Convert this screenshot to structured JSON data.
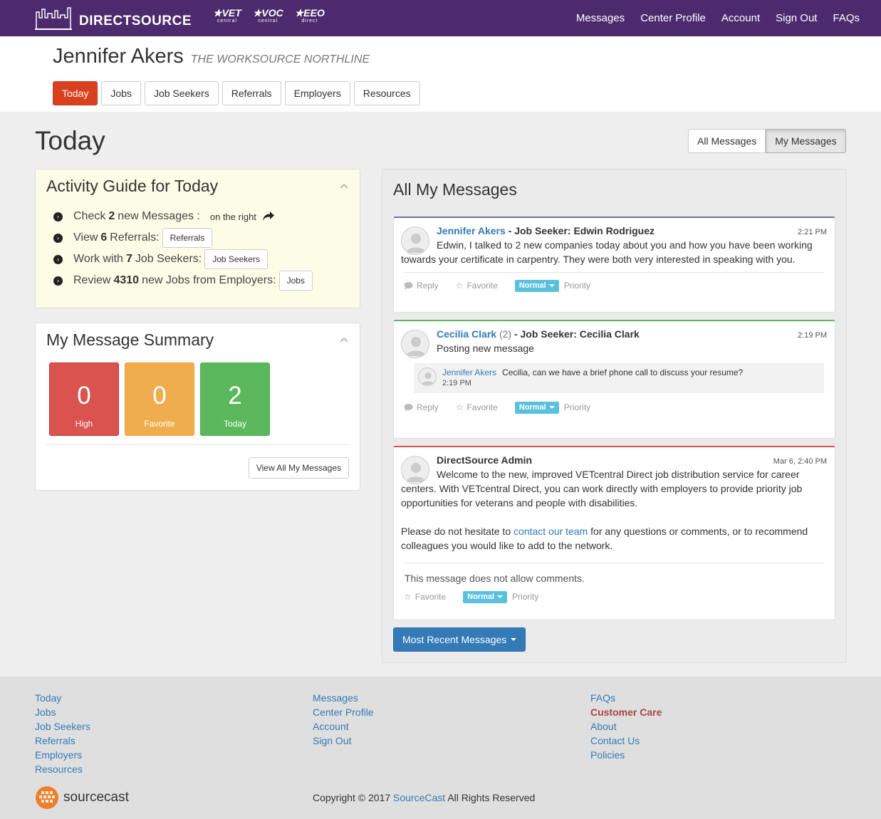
{
  "brand": {
    "name": "DIRECTSOURCE",
    "partners": [
      {
        "name": "VET",
        "sub": "central"
      },
      {
        "name": "VOC",
        "sub": "central"
      },
      {
        "name": "EEO",
        "sub": "direct"
      }
    ]
  },
  "topnav": [
    "Messages",
    "Center Profile",
    "Account",
    "Sign Out",
    "FAQs"
  ],
  "header": {
    "user_name": "Jennifer Akers",
    "center": "THE WORKSOURCE NORTHLINE"
  },
  "tabs": [
    "Today",
    "Jobs",
    "Job Seekers",
    "Referrals",
    "Employers",
    "Resources"
  ],
  "page_title": "Today",
  "message_toggle": {
    "all": "All Messages",
    "mine": "My Messages"
  },
  "guide": {
    "title": "Activity Guide for Today",
    "items": [
      {
        "pre": "Check",
        "count": "2",
        "post": "new Messages :",
        "extra": "on the right"
      },
      {
        "pre": "View",
        "count": "6",
        "post": "Referrals:",
        "button": "Referrals"
      },
      {
        "pre": "Work with",
        "count": "7",
        "post": "Job Seekers:",
        "button": "Job Seekers"
      },
      {
        "pre": "Review",
        "count": "4310",
        "post": "new Jobs from Employers:",
        "button": "Jobs"
      }
    ]
  },
  "summary": {
    "title": "My Message Summary",
    "tiles": [
      {
        "value": "0",
        "label": "High"
      },
      {
        "value": "0",
        "label": "Favorite"
      },
      {
        "value": "2",
        "label": "Today"
      }
    ],
    "view_all": "View All My Messages"
  },
  "messages": {
    "title": "All My Messages",
    "items": [
      {
        "sender": "Jennifer Akers",
        "subject": "- Job Seeker: Edwin Rodriguez",
        "time": "2:21 PM",
        "body": "Edwin, I talked to 2 new companies today about you and how you have been working towards your certificate in carpentry. They were both very interested in speaking with you."
      },
      {
        "sender": "Cecilia Clark",
        "count": "(2)",
        "subject": "- Job Seeker: Cecilia Clark",
        "time": "2:19 PM",
        "body": "Posting new message",
        "reply": {
          "sender": "Jennifer Akers",
          "text": "Cecilia, can we have a brief phone call to discuss your resume?",
          "time": "2:19 PM"
        }
      },
      {
        "sender": "DirectSource Admin",
        "time": "Mar 6, 2:40 PM",
        "body1": "Welcome to the new, improved VETcentral Direct job distribution service for career centers. With VETcentral Direct, you can work directly with employers to provide priority job opportunities for veterans and people with disabilities.",
        "body2_pre": "Please do not hesitate to",
        "body2_link": "contact our team",
        "body2_post": "for any questions or comments, or to recommend colleagues you would like to add to the network.",
        "no_comments": "This message does not allow comments."
      }
    ],
    "actions": {
      "reply": "Reply",
      "favorite": "Favorite",
      "priority_value": "Normal",
      "priority": "Priority"
    },
    "recent_button": "Most Recent Messages"
  },
  "footer": {
    "col1": [
      "Today",
      "Jobs",
      "Job Seekers",
      "Referrals",
      "Employers",
      "Resources"
    ],
    "col2": [
      "Messages",
      "Center Profile",
      "Account",
      "Sign Out"
    ],
    "col3": [
      "FAQs",
      "Customer Care",
      "About",
      "Contact Us",
      "Policies"
    ],
    "logo": "sourcecast",
    "copyright_pre": "Copyright © 2017",
    "copyright_link": "SourceCast",
    "copyright_post": "All Rights Reserved"
  },
  "colors": {
    "topbar": "#4d2a6e",
    "active_tab": "#d9411e",
    "guide_bg": "#fdfde7",
    "high": "#d9534f",
    "favorite": "#f0ad4e",
    "today": "#5cb85c",
    "link": "#337ab7"
  }
}
